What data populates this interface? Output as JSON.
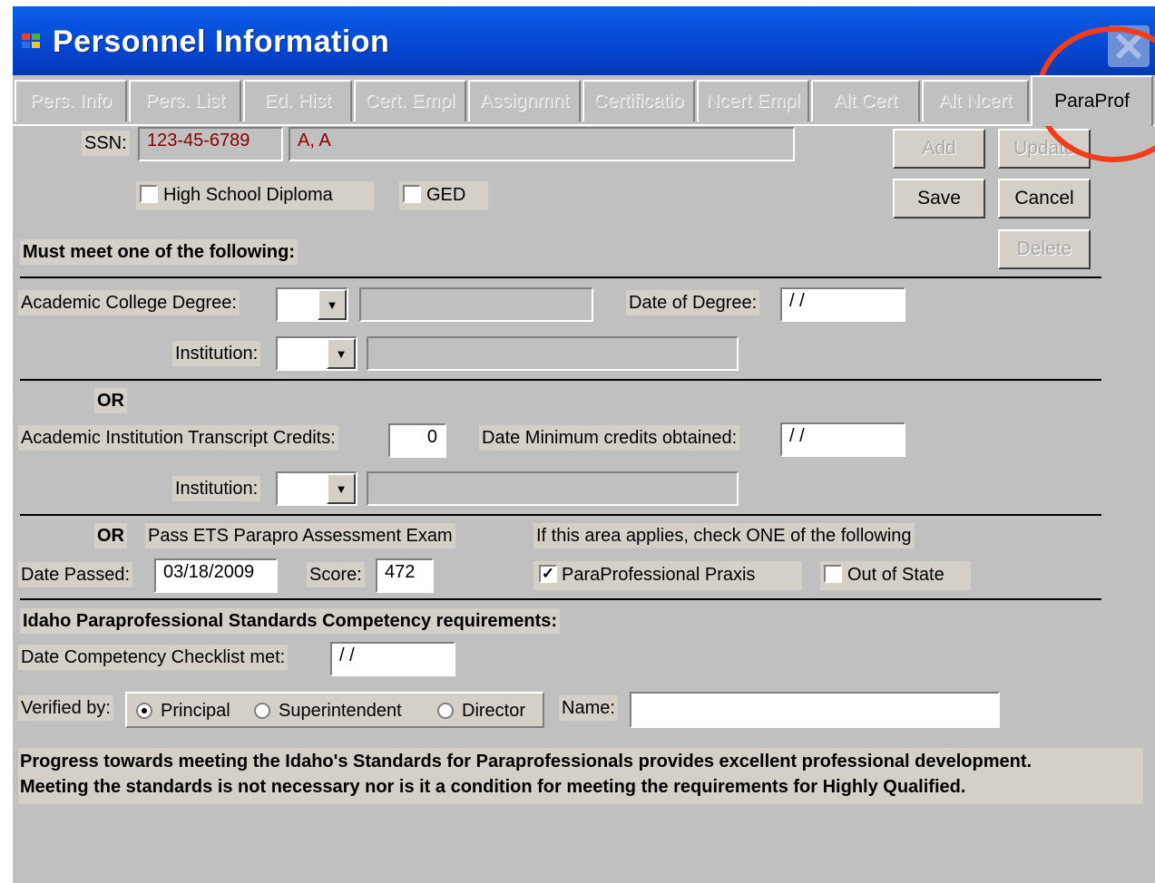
{
  "window": {
    "title": "Personnel Information",
    "close_icon": "close-x-icon",
    "app_icon": "windows-logo-icon"
  },
  "tabs": [
    {
      "label": "Pers. Info",
      "active": false
    },
    {
      "label": "Pers. List",
      "active": false
    },
    {
      "label": "Ed. Hist",
      "active": false
    },
    {
      "label": "Cert. Empl",
      "active": false
    },
    {
      "label": "Assignmnt",
      "active": false
    },
    {
      "label": "Certificatio",
      "active": false
    },
    {
      "label": "Ncert Empl",
      "active": false
    },
    {
      "label": "Alt Cert",
      "active": false
    },
    {
      "label": "Alt Ncert",
      "active": false
    },
    {
      "label": "ParaProf",
      "active": true
    }
  ],
  "ssn": {
    "label": "SSN:",
    "value": "123-45-6789",
    "name_value": "A, A"
  },
  "buttons": {
    "add": "Add",
    "update": "Update",
    "save": "Save",
    "cancel": "Cancel",
    "delete": "Delete"
  },
  "diploma": {
    "hs_label": "High School Diploma",
    "hs_checked": false,
    "ged_label": "GED",
    "ged_checked": false
  },
  "must_meet": "Must meet one of the following:",
  "degree": {
    "label": "Academic College Degree:",
    "date_label": "Date of Degree:",
    "date_value": " / /",
    "institution_label": "Institution:"
  },
  "or_label": "OR",
  "credits": {
    "label": "Academic Institution Transcript Credits:",
    "value": "0",
    "date_label": "Date Minimum credits obtained:",
    "date_value": " / /",
    "institution_label": "Institution:"
  },
  "exam": {
    "label": "Pass ETS Parapro Assessment Exam",
    "applies_label": "If this area applies, check ONE of the following",
    "date_passed_label": "Date Passed:",
    "date_passed_value": "03/18/2009",
    "score_label": "Score:",
    "score_value": "472",
    "praxis_label": "ParaProfessional Praxis",
    "praxis_checked": true,
    "out_of_state_label": "Out of State",
    "out_of_state_checked": false
  },
  "competency": {
    "heading": "Idaho Paraprofessional Standards Competency requirements:",
    "date_label": "Date Competency Checklist met:",
    "date_value": " / /",
    "verified_label": "Verified by:",
    "options": [
      "Principal",
      "Superintendent",
      "Director"
    ],
    "selected": "Principal",
    "name_label": "Name:",
    "name_value": ""
  },
  "note": {
    "line1": "Progress towards meeting the Idaho's Standards for Paraprofessionals provides excellent professional development.",
    "line2": "Meeting the standards is not necessary nor is it a condition for meeting the requirements for Highly Qualified."
  },
  "colors": {
    "titlebar": "#0546d2",
    "highlight_circle": "#f23c1a",
    "ssn_text": "#8b0000"
  }
}
